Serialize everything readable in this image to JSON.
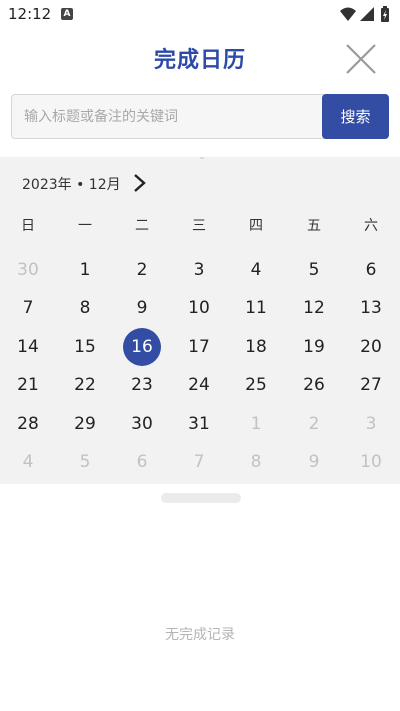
{
  "status_bar": {
    "time": "12:12",
    "notification_icon": "A",
    "icons": [
      "wifi-icon",
      "signal-icon",
      "battery-charging-icon"
    ]
  },
  "header": {
    "title": "完成日历",
    "close_icon": "close-icon"
  },
  "search": {
    "placeholder": "输入标题或备注的关键词",
    "value": "",
    "button_label": "搜索"
  },
  "calendar": {
    "month_label": "2023年 • 12月",
    "next_icon": "chevron-right-icon",
    "weekdays": [
      "日",
      "一",
      "二",
      "三",
      "四",
      "五",
      "六"
    ],
    "weeks": [
      [
        {
          "d": "30",
          "muted": true
        },
        {
          "d": "1"
        },
        {
          "d": "2"
        },
        {
          "d": "3"
        },
        {
          "d": "4"
        },
        {
          "d": "5"
        },
        {
          "d": "6"
        }
      ],
      [
        {
          "d": "7"
        },
        {
          "d": "8"
        },
        {
          "d": "9"
        },
        {
          "d": "10"
        },
        {
          "d": "11"
        },
        {
          "d": "12"
        },
        {
          "d": "13"
        }
      ],
      [
        {
          "d": "14"
        },
        {
          "d": "15"
        },
        {
          "d": "16",
          "selected": true
        },
        {
          "d": "17"
        },
        {
          "d": "18"
        },
        {
          "d": "19"
        },
        {
          "d": "20"
        }
      ],
      [
        {
          "d": "21"
        },
        {
          "d": "22"
        },
        {
          "d": "23"
        },
        {
          "d": "24"
        },
        {
          "d": "25"
        },
        {
          "d": "26"
        },
        {
          "d": "27"
        }
      ],
      [
        {
          "d": "28"
        },
        {
          "d": "29"
        },
        {
          "d": "30"
        },
        {
          "d": "31"
        },
        {
          "d": "1",
          "muted": true
        },
        {
          "d": "2",
          "muted": true
        },
        {
          "d": "3",
          "muted": true
        }
      ],
      [
        {
          "d": "4",
          "muted": true
        },
        {
          "d": "5",
          "muted": true
        },
        {
          "d": "6",
          "muted": true
        },
        {
          "d": "7",
          "muted": true
        },
        {
          "d": "8",
          "muted": true
        },
        {
          "d": "9",
          "muted": true
        },
        {
          "d": "10",
          "muted": true
        }
      ]
    ]
  },
  "records": {
    "empty_text": "无完成记录"
  },
  "colors": {
    "accent": "#334ca4",
    "title": "#2d4aa8",
    "calendar_bg": "#f2f2f2",
    "muted_day": "#c2c2c2"
  }
}
